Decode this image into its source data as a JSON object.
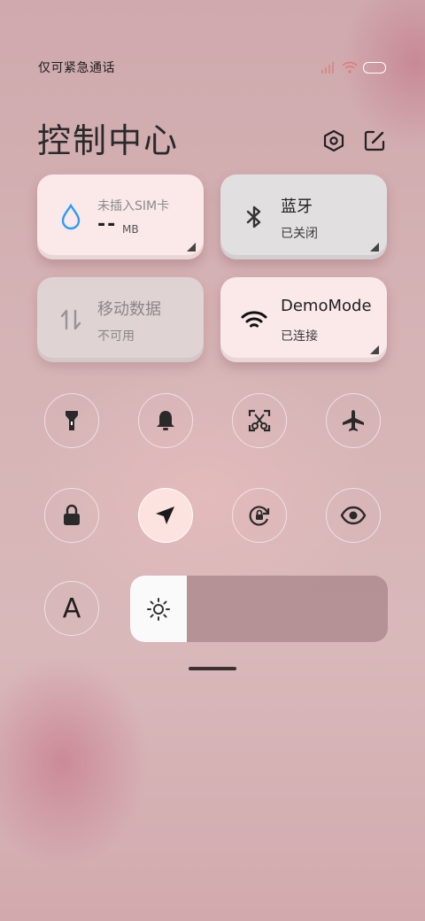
{
  "status_bar": {
    "carrier": "仅可紧急通话",
    "icons": [
      "signal-icon",
      "wifi-icon",
      "battery-icon"
    ]
  },
  "header": {
    "title": "控制中心",
    "settings_icon": "hexagon-settings-icon",
    "edit_icon": "edit-icon"
  },
  "tiles": {
    "data_usage": {
      "label": "未插入SIM卡",
      "value": "--",
      "unit": "MB",
      "icon": "water-drop-icon"
    },
    "bluetooth": {
      "title": "蓝牙",
      "status": "已关闭",
      "icon": "bluetooth-icon"
    },
    "mobile_data": {
      "title": "移动数据",
      "status": "不可用",
      "icon": "data-arrows-icon"
    },
    "wifi": {
      "title": "DemoMode",
      "status": "已连接",
      "icon": "wifi-icon"
    }
  },
  "toggles": [
    {
      "name": "flashlight-icon",
      "active": false
    },
    {
      "name": "bell-icon",
      "active": false
    },
    {
      "name": "screenshot-icon",
      "active": false
    },
    {
      "name": "airplane-icon",
      "active": false
    },
    {
      "name": "lock-icon",
      "active": false
    },
    {
      "name": "location-icon",
      "active": true
    },
    {
      "name": "rotation-lock-icon",
      "active": false
    },
    {
      "name": "eye-icon",
      "active": false
    },
    {
      "name": "auto-brightness-icon",
      "active": false
    }
  ],
  "auto_brightness_letter": "A",
  "brightness": {
    "level": 0.22,
    "icon": "sun-icon"
  },
  "colors": {
    "active_tile": "#fbe8e8",
    "inactive_tile": "#e1dfdf",
    "accent_blue": "#2a9df4"
  }
}
